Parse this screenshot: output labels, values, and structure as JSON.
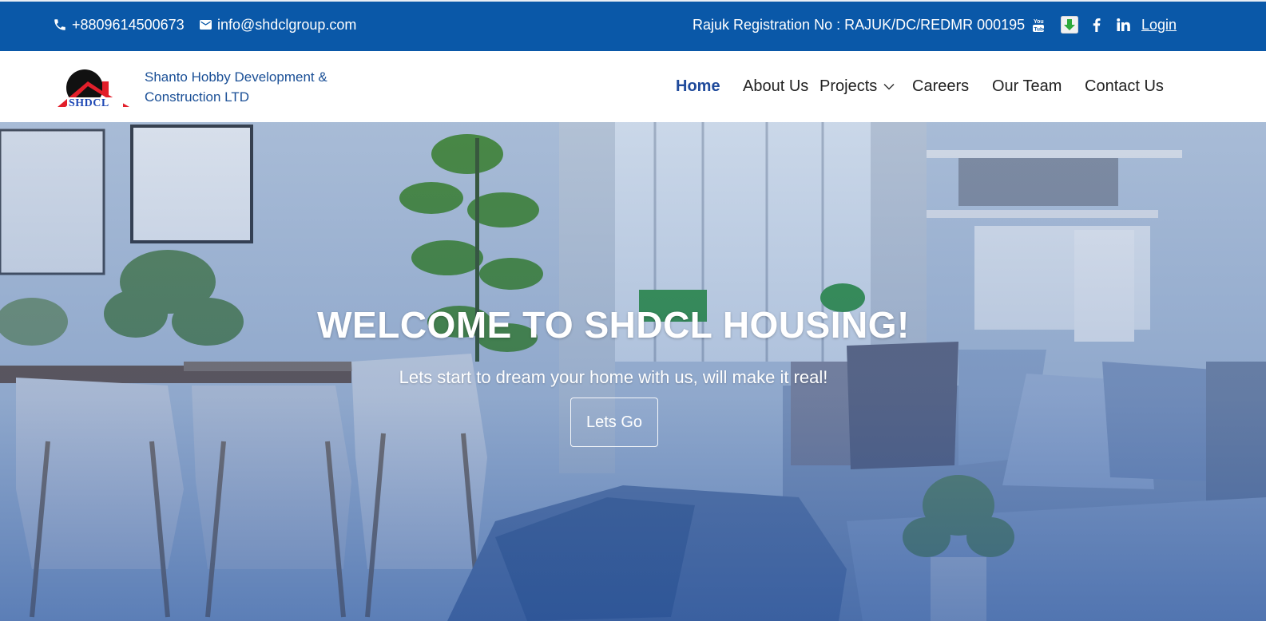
{
  "topbar": {
    "phone": "+8809614500673",
    "email": "info@shdclgroup.com",
    "registration": "Rajuk Registration No : RAJUK/DC/REDMR 000195",
    "login_label": "Login",
    "icons": [
      "phone-icon",
      "mail-icon",
      "youtube-icon",
      "download-icon",
      "facebook-icon",
      "linkedin-icon"
    ],
    "background_color": "#0a58a8"
  },
  "header": {
    "logo_text": "SHDCL",
    "company_name_line1": "Shanto Hobby Development &",
    "company_name_line2": "Construction LTD",
    "brand_color": "#1a4f96"
  },
  "nav": {
    "items": [
      {
        "label": "Home",
        "active": true
      },
      {
        "label": "About Us",
        "active": false
      },
      {
        "label": "Projects",
        "active": false,
        "has_dropdown": true
      },
      {
        "label": "Careers",
        "active": false
      },
      {
        "label": "Our Team",
        "active": false
      },
      {
        "label": "Contact Us",
        "active": false
      }
    ],
    "active_color": "#1f4a9b"
  },
  "hero": {
    "title": "WELCOME TO SHDCL HOUSING!",
    "subtitle": "Lets start to dream your home with us, will make it real!",
    "button_label": "Lets Go"
  }
}
